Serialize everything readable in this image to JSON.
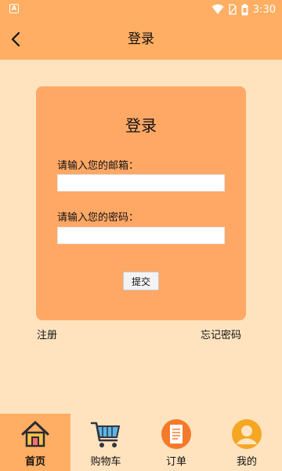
{
  "status_bar": {
    "time": "3:30",
    "app_badge": "A",
    "icons": [
      "wifi-icon",
      "sim-icon",
      "battery-icon"
    ]
  },
  "app_bar": {
    "title": "登录",
    "back_icon": "chevron-left-icon"
  },
  "login": {
    "title": "登录",
    "email_label": "请输入您的邮箱：",
    "email_value": "",
    "password_label": "请输入您的密码：",
    "password_value": "",
    "submit_label": "提交"
  },
  "links": {
    "register": "注册",
    "forgot_password": "忘记密码"
  },
  "bottom_nav": {
    "items": [
      {
        "label": "首页",
        "icon": "home-icon",
        "active": true
      },
      {
        "label": "购物车",
        "icon": "cart-icon",
        "active": false
      },
      {
        "label": "订单",
        "icon": "order-icon",
        "active": false
      },
      {
        "label": "我的",
        "icon": "user-icon",
        "active": false
      }
    ]
  },
  "colors": {
    "primary": "#FFAE63",
    "background": "#FFE3BF",
    "card": "#FFA866"
  }
}
